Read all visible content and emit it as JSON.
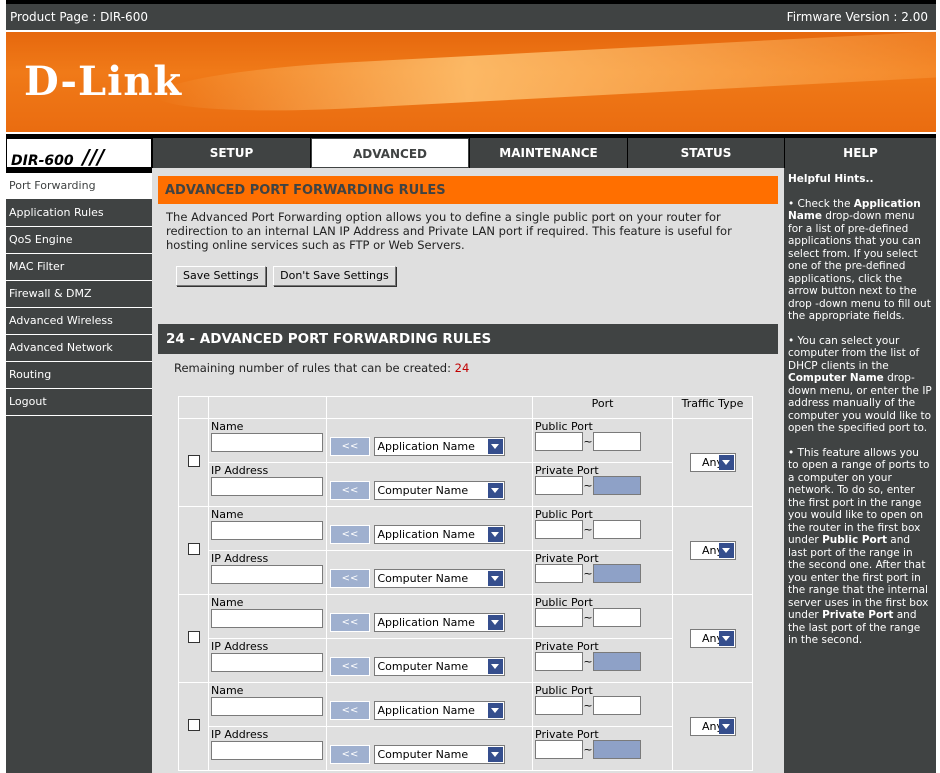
{
  "topbar": {
    "product": "Product Page : DIR-600",
    "firmware": "Firmware Version : 2.00"
  },
  "brand": {
    "logo": "D-Link",
    "model": "DIR-600",
    "slashes": "///"
  },
  "tabs": [
    {
      "label": "SETUP"
    },
    {
      "label": "ADVANCED"
    },
    {
      "label": "MAINTENANCE"
    },
    {
      "label": "STATUS"
    },
    {
      "label": "HELP"
    }
  ],
  "sidebar": {
    "items": [
      {
        "label": "Port Forwarding"
      },
      {
        "label": "Application Rules"
      },
      {
        "label": "QoS Engine"
      },
      {
        "label": "MAC Filter"
      },
      {
        "label": "Firewall & DMZ"
      },
      {
        "label": "Advanced Wireless"
      },
      {
        "label": "Advanced Network"
      },
      {
        "label": "Routing"
      },
      {
        "label": "Logout"
      }
    ]
  },
  "section1": {
    "title": "ADVANCED PORT FORWARDING RULES",
    "description": "The Advanced Port Forwarding option allows you to define a single public port on your router for redirection to an internal LAN IP Address and Private LAN port if required. This feature is useful for hosting online services such as FTP or Web Servers.",
    "save_label": "Save Settings",
    "dont_save_label": "Don't Save Settings"
  },
  "section2": {
    "title": "24 - ADVANCED PORT FORWARDING RULES",
    "remaining_label": "Remaining number of rules that can be created:",
    "remaining_count": "24",
    "headers": {
      "port": "Port",
      "traffic": "Traffic Type"
    },
    "row_labels": {
      "name": "Name",
      "ip": "IP Address",
      "public_port": "Public Port",
      "private_port": "Private Port",
      "arrow": "<<",
      "app_select": "Application Name",
      "computer_select": "Computer Name",
      "traffic_value": "Any",
      "tilde": "~"
    }
  },
  "help": {
    "title": "Helpful Hints..",
    "p1_a": "• Check the ",
    "p1_b": "Application Name",
    "p1_c": " drop-down menu for a list of pre-defined applications that you can select from. If you select one of the pre-defined applications, click the arrow button next to the drop -down menu to fill out the appropriate fields.",
    "p2_a": "• You can select your computer from the list of DHCP clients in the ",
    "p2_b": "Computer Name",
    "p2_c": " drop-down menu, or enter the IP address manually of the computer you would like to open the specified port to.",
    "p3_a": "• This feature allows you to open a range of ports to a computer on your network. To do so, enter the first port in the range you would like to open on the router in the first box under ",
    "p3_b": "Public Port",
    "p3_c": " and last port of the range in the second one. After that you enter the first port in the range that the internal server uses in the first box under ",
    "p3_d": "Private Port",
    "p3_e": " and the last port of the range in the second."
  }
}
